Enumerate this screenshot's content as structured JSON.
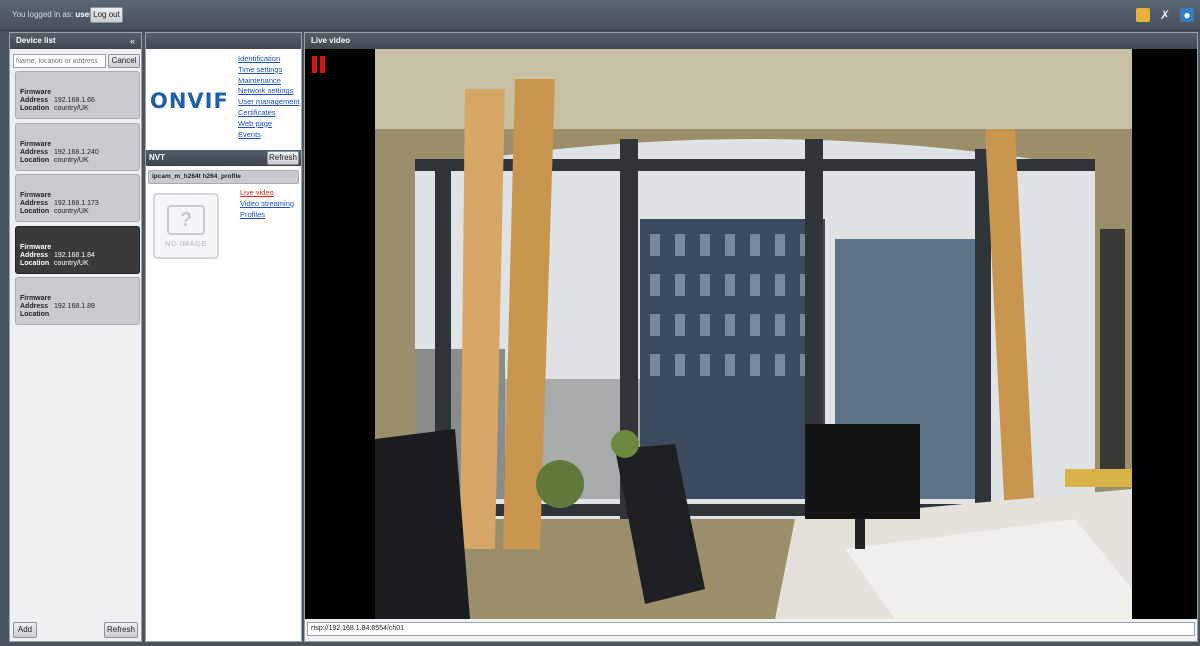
{
  "topbar": {
    "logged_prefix": "You logged in as:",
    "user": "user",
    "logout_label": "Log out",
    "icons": [
      "folder-icon",
      "tools-icon",
      "user-icon"
    ]
  },
  "device_list": {
    "title": "Device list",
    "collapse": "«",
    "search_placeholder": "Name, location or address",
    "cancel_label": "Cancel",
    "labels": {
      "firmware": "Firmware",
      "address": "Address",
      "location": "Location"
    },
    "devices": [
      {
        "address": "192.168.1.66",
        "location": "country/UK",
        "selected": false
      },
      {
        "address": "192.168.1.240",
        "location": "country/UK",
        "selected": false
      },
      {
        "address": "192.168.1.173",
        "location": "country/UK",
        "selected": false
      },
      {
        "address": "192.168.1.84",
        "location": "country/UK",
        "selected": true
      },
      {
        "address": "192.168.1.89",
        "location": "",
        "selected": false
      }
    ],
    "add_label": "Add",
    "refresh_label": "Refresh"
  },
  "device_panel": {
    "logo_text": "ONVIF",
    "links": [
      "Identification",
      "Time settings",
      "Maintenance",
      "Network settings",
      "User management",
      "Certificates",
      "Web page",
      "Events"
    ],
    "nvt_label": "NVT",
    "nvt_refresh": "Refresh",
    "profile_name": "ipcam_m_h264t h264_profile",
    "no_image": "NO IMAGE",
    "nvt_links": [
      {
        "label": "Live video",
        "active": true
      },
      {
        "label": "Video streaming",
        "active": false
      },
      {
        "label": "Profiles",
        "active": false
      }
    ]
  },
  "live_video": {
    "title": "Live video",
    "stream_url": "rtsp://192.168.1.84:8554/ch01"
  },
  "colors": {
    "header_bg": "#404952",
    "selected_card": "#3a3a3a",
    "link": "#1d4fc9",
    "active_link": "#e0231c",
    "pause": "#d4151b"
  }
}
